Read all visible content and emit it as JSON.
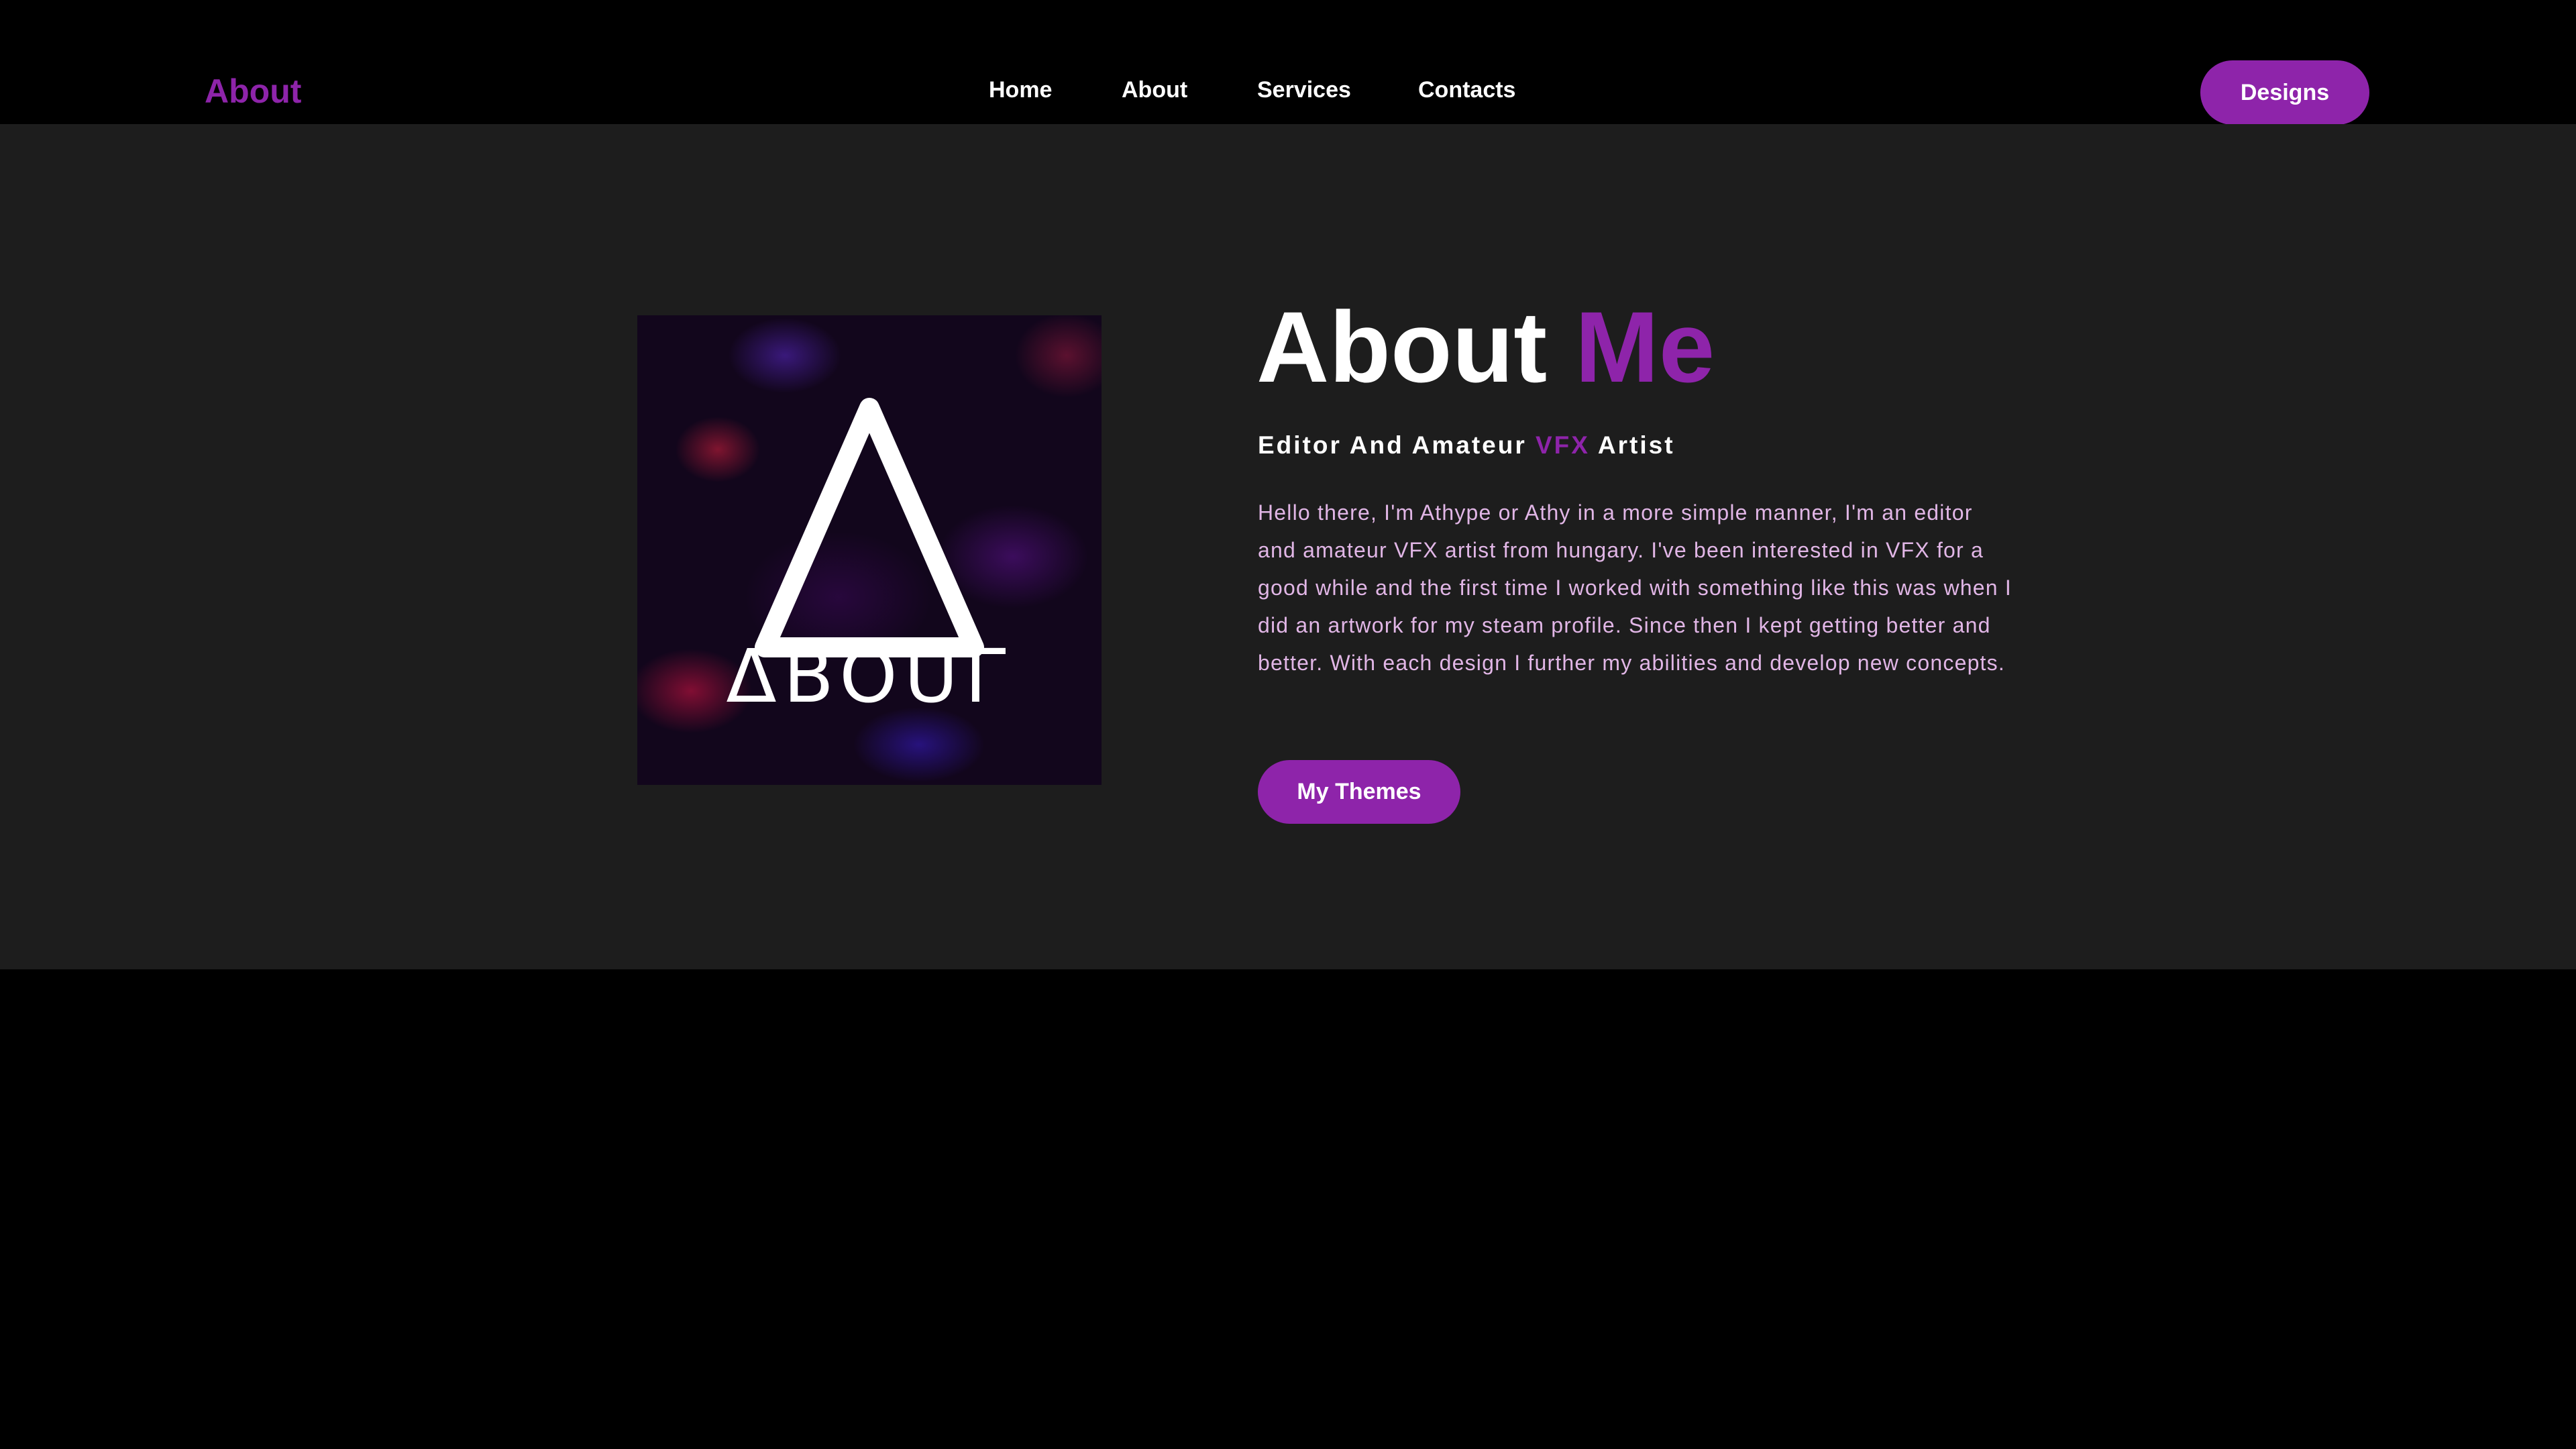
{
  "brand": {
    "name": "About"
  },
  "nav": {
    "items": [
      {
        "label": "Home"
      },
      {
        "label": "About"
      },
      {
        "label": "Services"
      },
      {
        "label": "Contacts"
      }
    ],
    "cta_label": "Designs"
  },
  "about": {
    "heading_part1": "About",
    "heading_accent": "Me",
    "subtitle_part1": "Editor And Amateur",
    "subtitle_accent": "VFX",
    "subtitle_part2": "Artist",
    "bio": "Hello there, I'm Athype or Athy in a more simple manner, I'm an editor and amateur VFX artist from hungary. I've been interested in VFX for a good while and the first time I worked with something like this was when I did an artwork for my steam profile. Since then I kept getting better and better. With each design I further my abilities and develop new concepts.",
    "button_label": "My Themes",
    "logo_text": "ΔBOUΓ"
  },
  "colors": {
    "accent": "#8e24aa",
    "page_background": "#000000",
    "section_background": "#1d1d1d",
    "bio_text": "#e1b6e6",
    "text": "#ffffff"
  }
}
